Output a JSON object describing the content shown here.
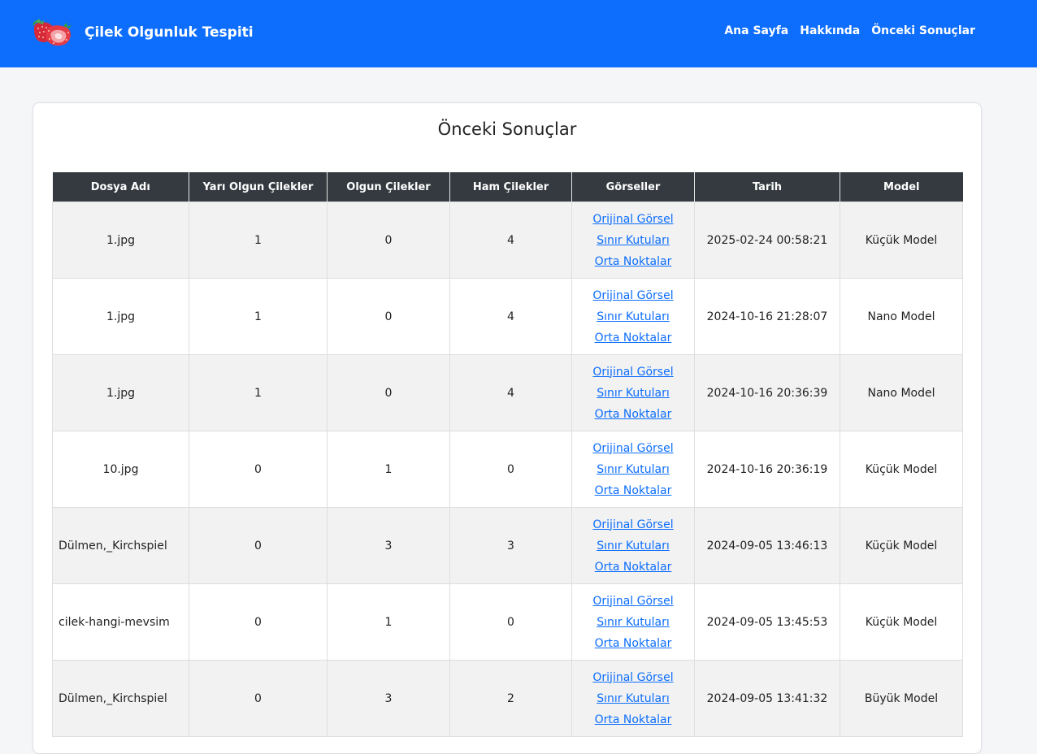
{
  "header": {
    "title": "Çilek Olgunluk Tespiti",
    "logo_icon": "strawberry-icon",
    "nav": [
      "Ana Sayfa",
      "Hakkında",
      "Önceki Sonuçlar"
    ]
  },
  "colors": {
    "navbar": "#0d6efd",
    "table_header": "#343a40",
    "link": "#0d6efd"
  },
  "main": {
    "title": "Önceki Sonuçlar",
    "columns": [
      "Dosya Adı",
      "Yarı Olgun Çilekler",
      "Olgun Çilekler",
      "Ham Çilekler",
      "Görseller",
      "Tarih",
      "Model"
    ],
    "link_labels": [
      "Orijinal Görsel",
      "Sınır Kutuları",
      "Orta Noktalar"
    ],
    "rows": [
      {
        "file": "1.jpg",
        "semi": "1",
        "ripe": "0",
        "raw": "4",
        "date": "2025-02-24 00:58:21",
        "model": "Küçük Model"
      },
      {
        "file": "1.jpg",
        "semi": "1",
        "ripe": "0",
        "raw": "4",
        "date": "2024-10-16 21:28:07",
        "model": "Nano Model"
      },
      {
        "file": "1.jpg",
        "semi": "1",
        "ripe": "0",
        "raw": "4",
        "date": "2024-10-16 20:36:39",
        "model": "Nano Model"
      },
      {
        "file": "10.jpg",
        "semi": "0",
        "ripe": "1",
        "raw": "0",
        "date": "2024-10-16 20:36:19",
        "model": "Küçük Model"
      },
      {
        "file": "Dülmen,_Kirchspiel",
        "semi": "0",
        "ripe": "3",
        "raw": "3",
        "date": "2024-09-05 13:46:13",
        "model": "Küçük Model"
      },
      {
        "file": "cilek-hangi-mevsim",
        "semi": "0",
        "ripe": "1",
        "raw": "0",
        "date": "2024-09-05 13:45:53",
        "model": "Küçük Model"
      },
      {
        "file": "Dülmen,_Kirchspiel",
        "semi": "0",
        "ripe": "3",
        "raw": "2",
        "date": "2024-09-05 13:41:32",
        "model": "Büyük Model"
      }
    ]
  }
}
